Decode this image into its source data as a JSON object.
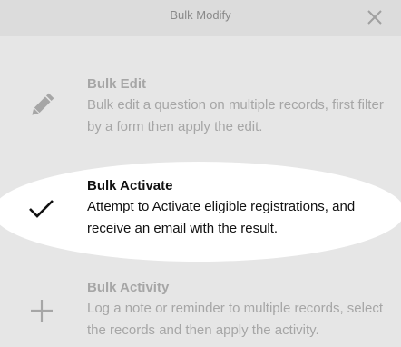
{
  "dialog": {
    "title": "Bulk Modify",
    "close_icon": "close-icon"
  },
  "options": [
    {
      "title": "Bulk Edit",
      "description": "Bulk edit a question on multiple records, first filter by a form then apply the edit.",
      "icon": "pencil-icon",
      "state": "disabled"
    },
    {
      "title": "Bulk Activate",
      "description": "Attempt to Activate eligible registrations, and receive an email with the result.",
      "icon": "checkmark-icon",
      "state": "active"
    },
    {
      "title": "Bulk Activity",
      "description": "Log a note or reminder to multiple records, select the records and then apply the activity.",
      "icon": "plus-icon",
      "state": "disabled"
    }
  ],
  "colors": {
    "background": "#e6e6e6",
    "header": "#dcdcdc",
    "disabled_text": "#a6a6a6",
    "active_text": "#111111",
    "highlight": "#ffffff"
  }
}
